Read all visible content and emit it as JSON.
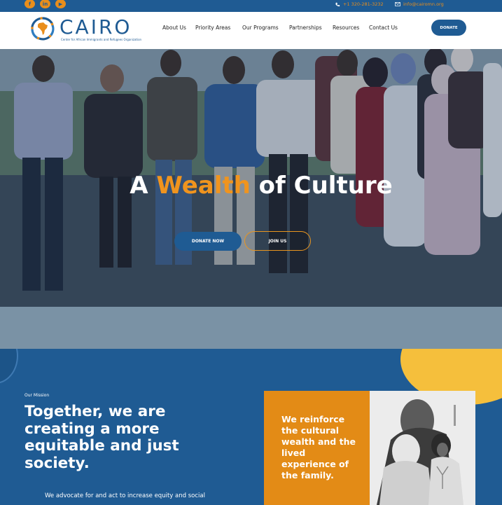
{
  "topbar": {
    "social": [
      {
        "icon": "facebook-icon",
        "glyph": "f"
      },
      {
        "icon": "linkedin-icon",
        "glyph": "in"
      },
      {
        "icon": "youtube-icon",
        "glyph": "▶"
      }
    ],
    "phone": "+1 320-281-3232",
    "email": "info@cairomn.org",
    "accent_color": "#e98e1c",
    "bar_color": "#1f5b93"
  },
  "header": {
    "logo_word": "CAIRO",
    "logo_tagline": "Center for African Immigrants and Refugees Organization",
    "nav": [
      "About Us",
      "Priority Areas",
      "Our Programs",
      "Partnerships",
      "Resources",
      "Contact Us"
    ],
    "donate_label": "DONATE"
  },
  "hero": {
    "title_prefix": "A ",
    "title_accent": "Wealth",
    "title_suffix": " of Culture",
    "donate_now_label": "DONATE NOW",
    "join_label": "JOIN US",
    "accent_color": "#f0941e"
  },
  "mission": {
    "label": "Our Mission",
    "heading": "Together, we are creating a more equitable and just society.",
    "body": "We advocate for and act to increase equity and social",
    "quote": "We reinforce the cultural wealth and the lived experience of the family.",
    "brand_color": "#1f5b93",
    "card_color": "#e38b16"
  }
}
